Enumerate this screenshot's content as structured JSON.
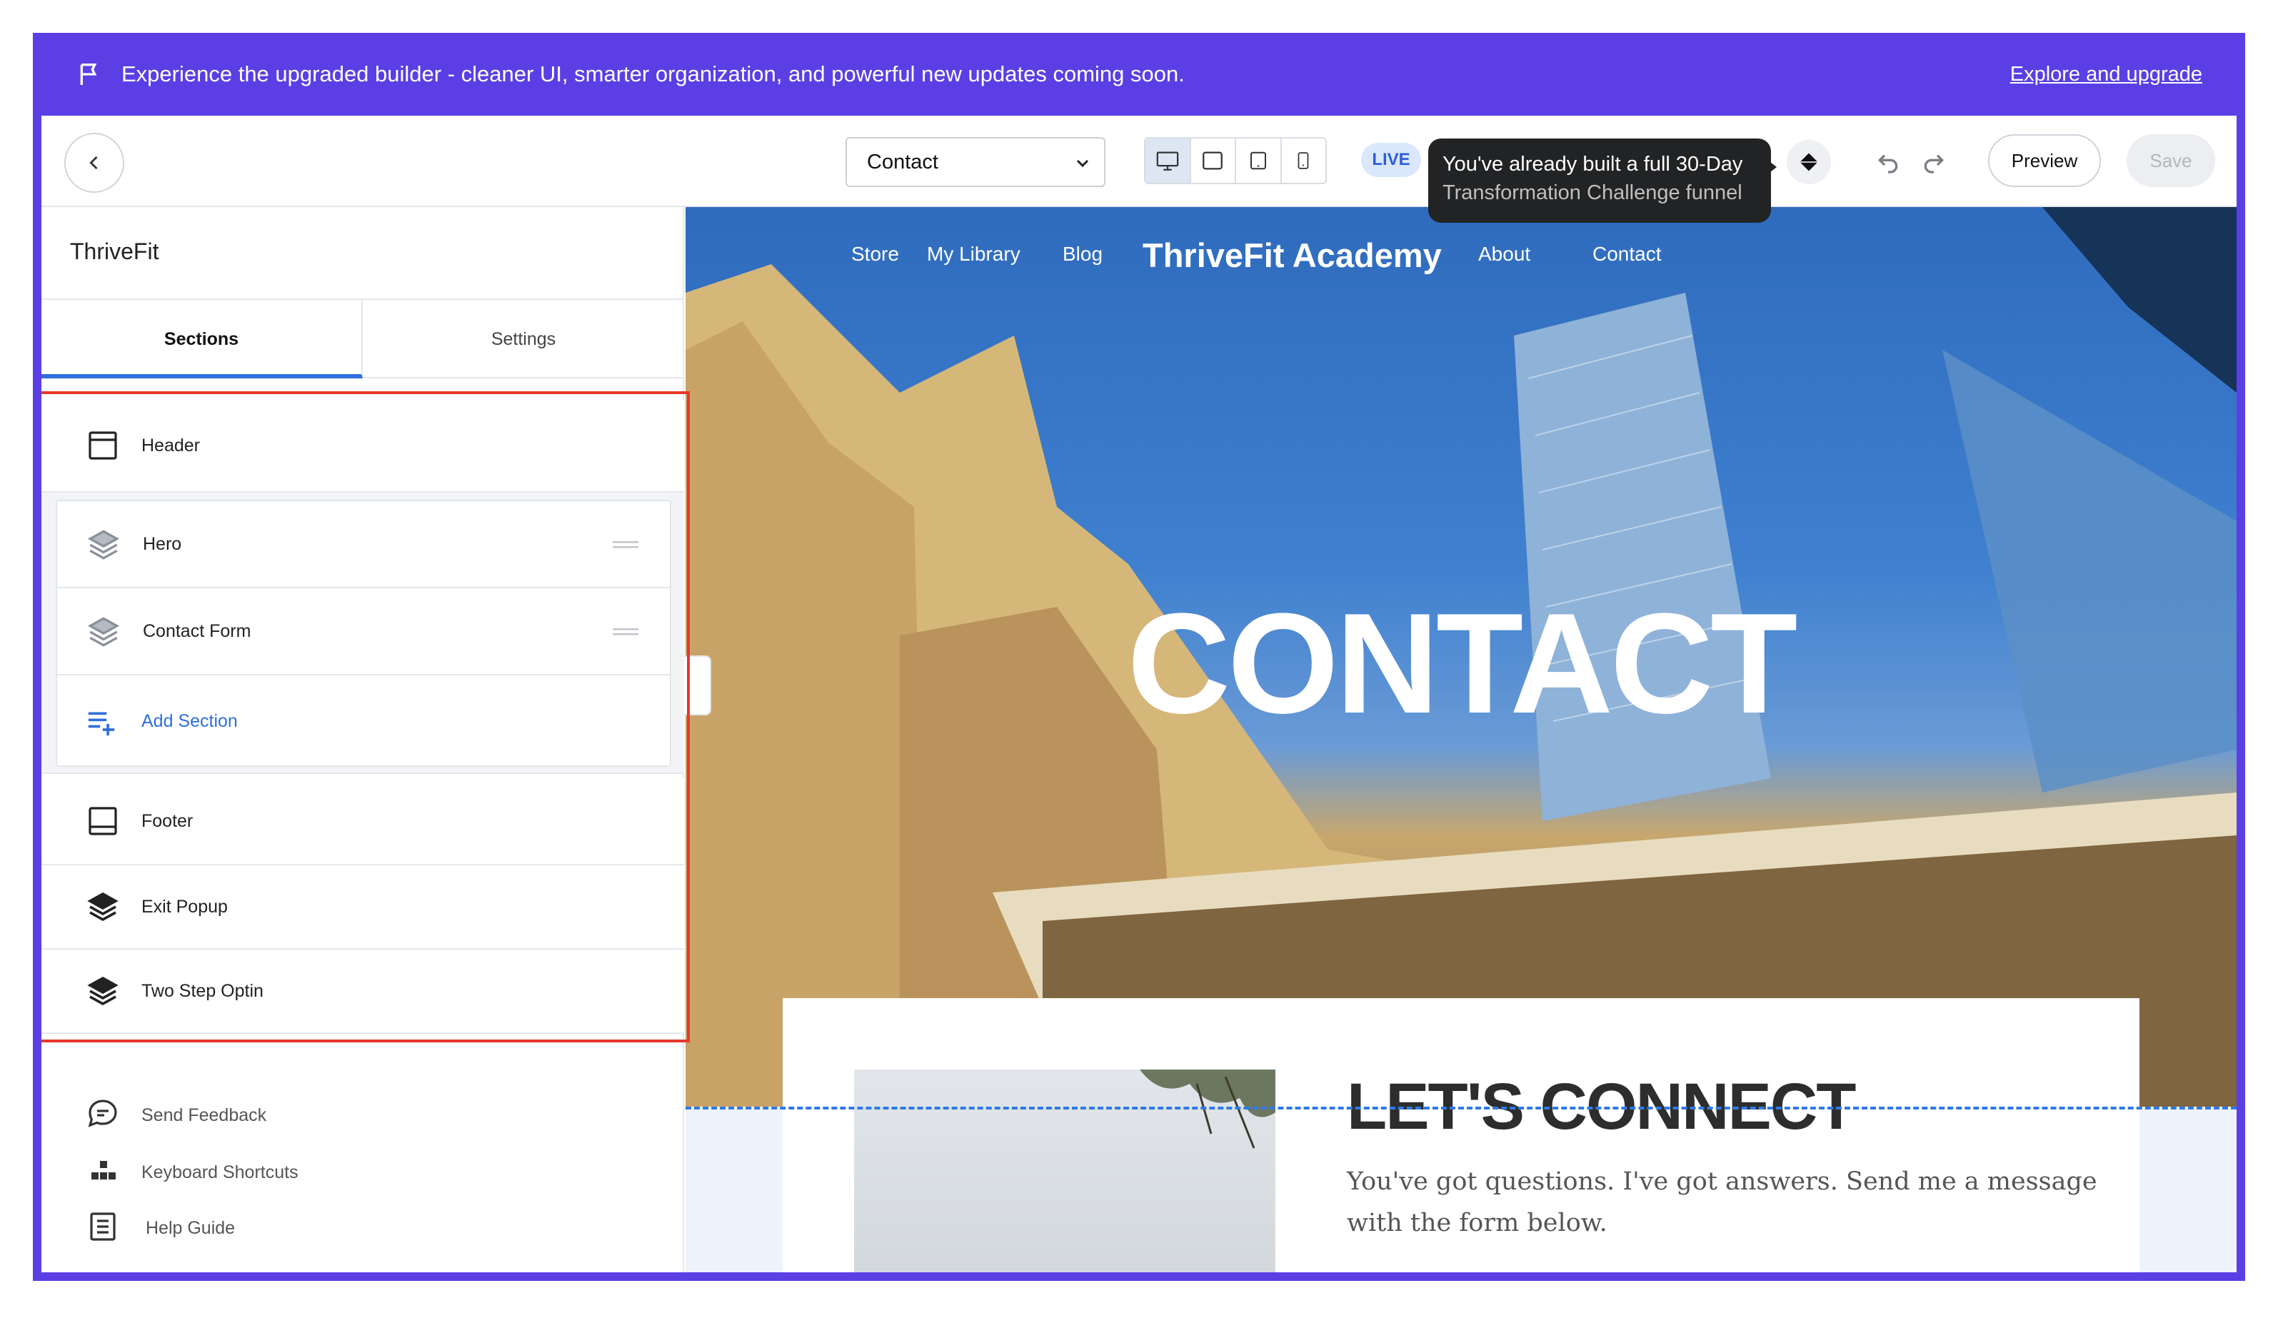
{
  "banner": {
    "message": "Experience the upgraded builder - cleaner UI, smarter organization, and powerful new updates coming soon.",
    "link": "Explore and upgrade",
    "background": "#5b3fe4"
  },
  "toolbar": {
    "page_select_value": "Contact",
    "live_badge": "LIVE",
    "tooltip_line1": "You've already built a full 30-Day",
    "tooltip_line2": "Transformation Challenge funnel",
    "preview_label": "Preview",
    "save_label": "Save"
  },
  "sidebar": {
    "brand": "ThriveFit",
    "tabs": [
      "Sections",
      "Settings"
    ],
    "active_tab": "Sections",
    "header_item": "Header",
    "group_items": [
      "Hero",
      "Contact Form"
    ],
    "add_section": "Add Section",
    "bottom_items": [
      "Footer",
      "Exit Popup",
      "Two Step Optin"
    ],
    "footer_links": [
      "Send Feedback",
      "Keyboard Shortcuts",
      "Help Guide"
    ]
  },
  "site": {
    "nav_left": [
      "Store",
      "My Library",
      "Blog"
    ],
    "logo": "ThriveFit Academy",
    "nav_right": [
      "About",
      "Contact"
    ],
    "hero_title": "CONTACT",
    "card_title": "LET'S CONNECT",
    "card_text": "You've got questions. I've got answers. Send me a message with the form below."
  },
  "colors": {
    "accent": "#2f6fdb",
    "highlight": "#e5392b",
    "dash": "#2f7ae6"
  }
}
